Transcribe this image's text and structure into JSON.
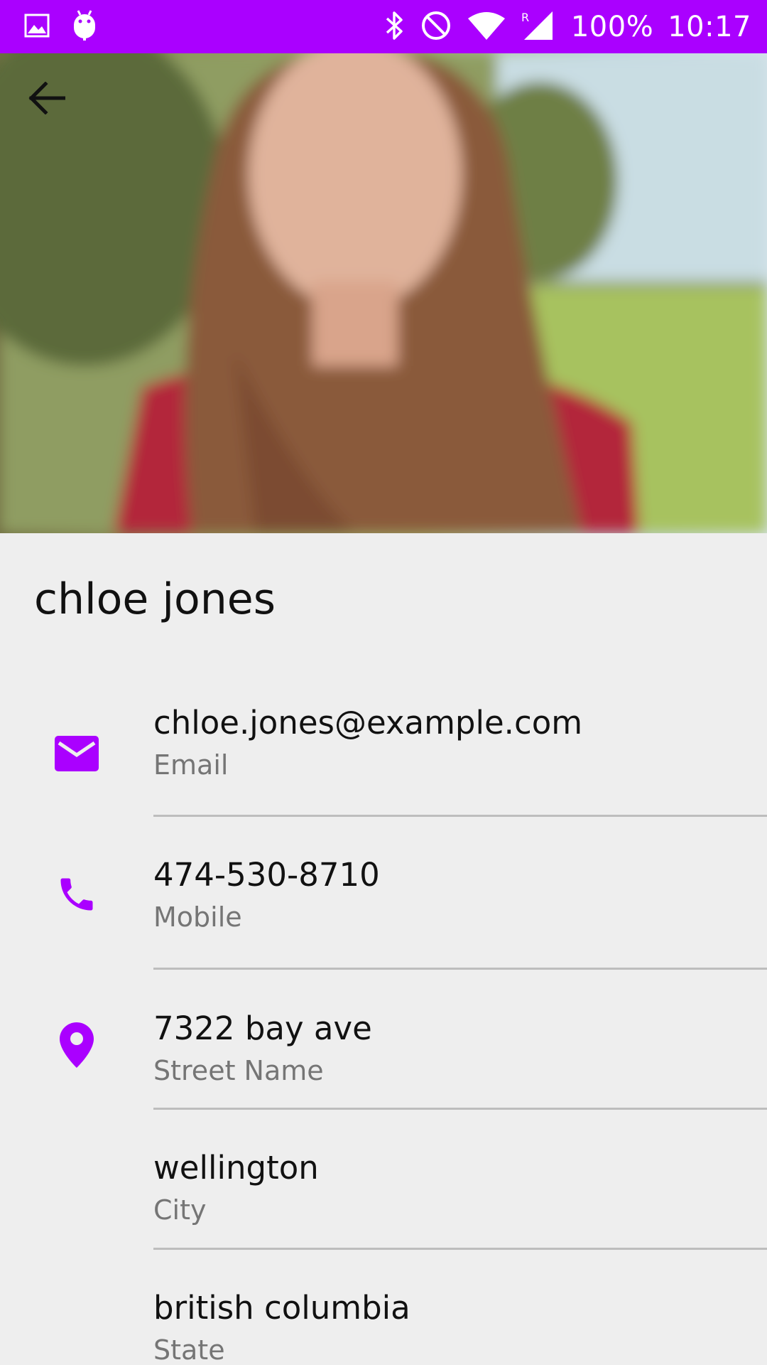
{
  "status_bar": {
    "battery": "100%",
    "time": "10:17",
    "background_color": "#aa00ff",
    "icons": [
      "gallery-icon",
      "android-icon",
      "bluetooth-icon",
      "do-not-disturb-icon",
      "wifi-icon",
      "signal-icon"
    ]
  },
  "hero": {
    "description_icon": "back-arrow-icon"
  },
  "contact": {
    "name": "chloe jones",
    "accent_color": "#aa00ff",
    "fields": [
      {
        "value": "chloe.jones@example.com",
        "label": "Email",
        "icon": "email-icon"
      },
      {
        "value": "474-530-8710",
        "label": "Mobile",
        "icon": "phone-icon"
      },
      {
        "value": "7322 bay ave",
        "label": "Street Name",
        "icon": "location-pin-icon"
      },
      {
        "value": "wellington",
        "label": "City",
        "icon": ""
      },
      {
        "value": "british columbia",
        "label": "State",
        "icon": ""
      }
    ]
  }
}
